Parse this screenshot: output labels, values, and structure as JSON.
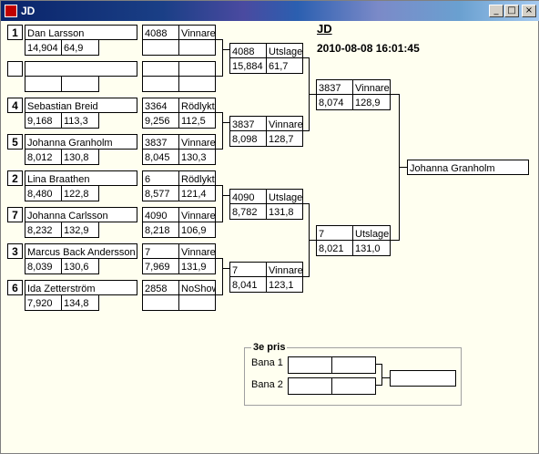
{
  "window": {
    "title": "JD",
    "minimize_icon": "minimize-icon",
    "maximize_icon": "maximize-icon",
    "close_icon": "close-icon",
    "minimize_glyph": "_",
    "maximize_glyph": "□",
    "close_glyph": "×"
  },
  "header": {
    "title": "JD",
    "datetime": "2010-08-08 16:01:45"
  },
  "round1": [
    {
      "seed": "1",
      "name": "Dan Larsson",
      "time": "14,904",
      "speed": "64,9"
    },
    {
      "seed": "",
      "name": "",
      "time": "",
      "speed": ""
    },
    {
      "seed": "4",
      "name": "Sebastian Breid",
      "time": "9,168",
      "speed": "113,3"
    },
    {
      "seed": "5",
      "name": "Johanna Granholm",
      "time": "8,012",
      "speed": "130,8"
    },
    {
      "seed": "2",
      "name": "Lina Braathen",
      "time": "8,480",
      "speed": "122,8"
    },
    {
      "seed": "7",
      "name": "Johanna Carlsson",
      "time": "8,232",
      "speed": "132,9"
    },
    {
      "seed": "3",
      "name": "Marcus Back Andersson",
      "time": "8,039",
      "speed": "130,6"
    },
    {
      "seed": "6",
      "name": "Ida Zetterström",
      "time": "7,920",
      "speed": "134,8"
    }
  ],
  "round1_results": [
    {
      "code": "4088",
      "status": "Vinnare",
      "time": "",
      "speed": ""
    },
    {
      "code": "",
      "status": "",
      "time": "",
      "speed": ""
    },
    {
      "code": "3364",
      "status": "Rödlykta",
      "time": "9,256",
      "speed": "112,5"
    },
    {
      "code": "3837",
      "status": "Vinnare",
      "time": "8,045",
      "speed": "130,3"
    },
    {
      "code": "6",
      "status": "Rödlykta",
      "time": "8,577",
      "speed": "121,4"
    },
    {
      "code": "4090",
      "status": "Vinnare",
      "time": "8,218",
      "speed": "106,9"
    },
    {
      "code": "7",
      "status": "Vinnare",
      "time": "7,969",
      "speed": "131,9"
    },
    {
      "code": "2858",
      "status": "NoShow",
      "time": "",
      "speed": ""
    }
  ],
  "round2": [
    {
      "code": "4088",
      "status": "Utslagen",
      "time": "15,884",
      "speed": "61,7"
    },
    {
      "code": "3837",
      "status": "Vinnare",
      "time": "8,098",
      "speed": "128,7"
    },
    {
      "code": "4090",
      "status": "Utslagen",
      "time": "8,782",
      "speed": "131,8"
    },
    {
      "code": "7",
      "status": "Vinnare",
      "time": "8,041",
      "speed": "123,1"
    }
  ],
  "round3": [
    {
      "code": "3837",
      "status": "Vinnare",
      "time": "8,074",
      "speed": "128,9"
    },
    {
      "code": "7",
      "status": "Utslagen",
      "time": "8,021",
      "speed": "131,0"
    }
  ],
  "winner": "Johanna Granholm",
  "third_place": {
    "legend": "3e pris",
    "lane1_label": "Bana 1",
    "lane2_label": "Bana 2",
    "lane1": [
      "",
      ""
    ],
    "lane2": [
      "",
      ""
    ],
    "result": ""
  }
}
